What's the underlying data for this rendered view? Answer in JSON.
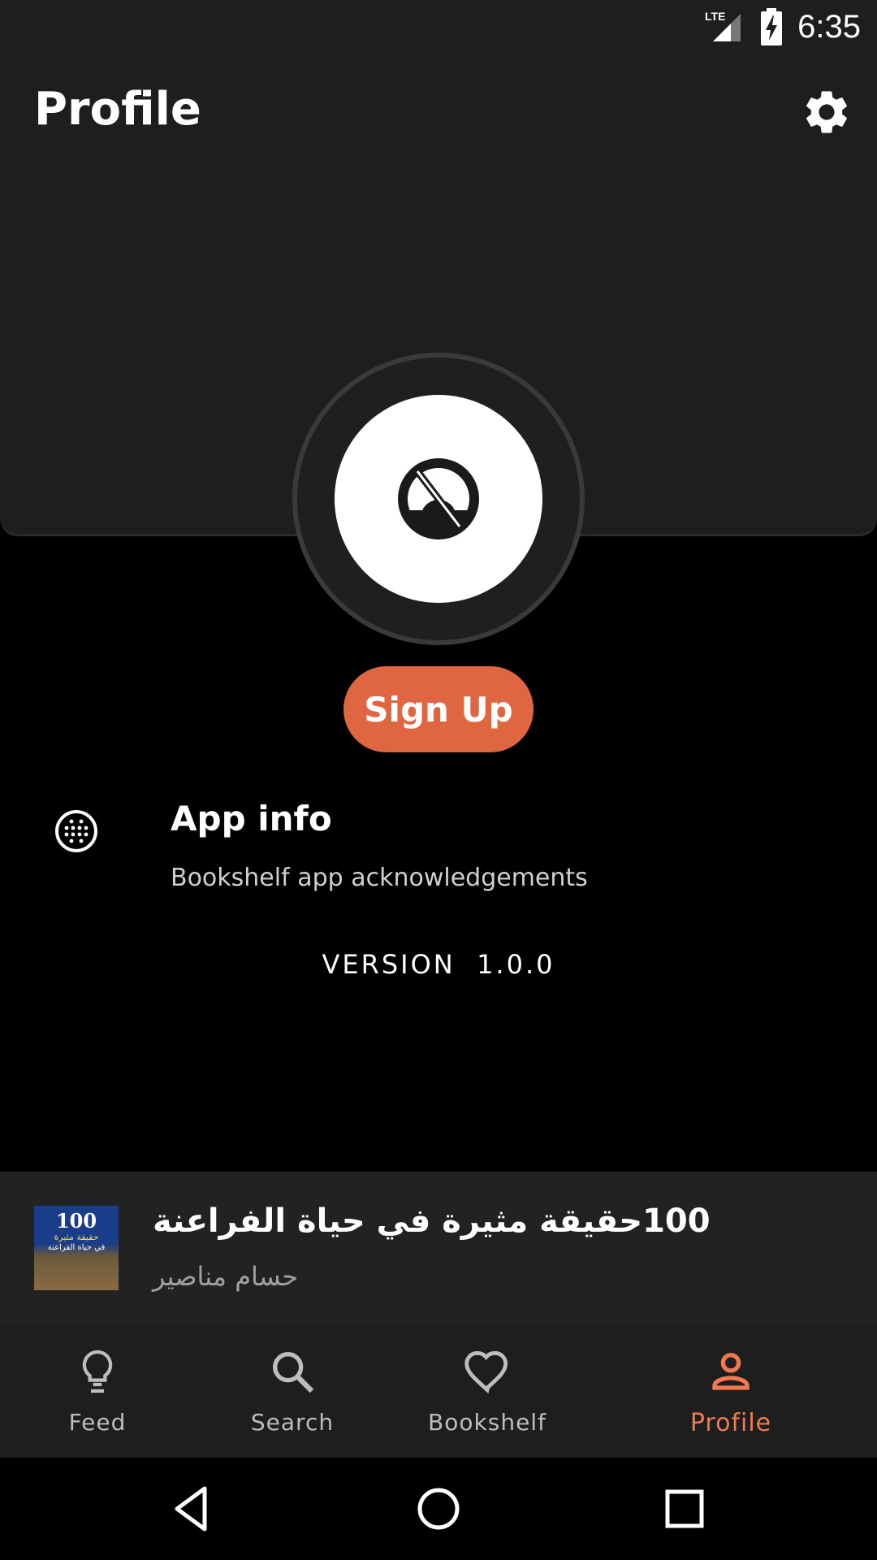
{
  "status_bar": {
    "network": "LTE",
    "time": "6:35"
  },
  "app_bar": {
    "title": "Profile",
    "settings_icon": "gear-icon"
  },
  "profile": {
    "avatar_icon": "no-avatar-icon",
    "signup_label": "Sign Up"
  },
  "app_info": {
    "title": "App info",
    "subtitle": "Bookshelf app acknowledgements",
    "icon": "app-info-icon"
  },
  "version": {
    "label": "VERSION",
    "number": "1.0.0"
  },
  "now_playing": {
    "title": "100حقيقة مثيرة في حياة الفراعنة",
    "author": "حسام مناصير",
    "cover_text": [
      "100",
      "حقيقة مثيرة",
      "في حياة الفراعنة"
    ]
  },
  "bottom_nav": {
    "items": [
      {
        "label": "Feed",
        "icon": "lightbulb-icon",
        "active": false
      },
      {
        "label": "Search",
        "icon": "search-icon",
        "active": false
      },
      {
        "label": "Bookshelf",
        "icon": "heart-icon",
        "active": false
      },
      {
        "label": "Profile",
        "icon": "person-icon",
        "active": true
      }
    ]
  },
  "colors": {
    "accent": "#e06641",
    "active_nav": "#f07a4f",
    "surface": "#1e1e1e",
    "background": "#000000"
  }
}
